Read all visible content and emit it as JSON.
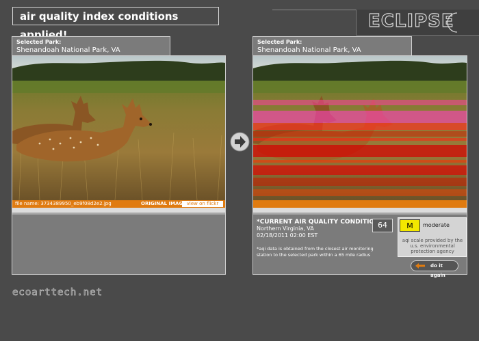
{
  "header": {
    "banner": "air quality index conditions applied!",
    "logo": "ECLIPSE",
    "logo_icon": "crescent-moon-icon"
  },
  "left_panel": {
    "label": "Selected Park:",
    "park": "Shenandoah National Park, VA",
    "file_name": "file name: 3734389950_eb9f08d2e2.jpg",
    "original_label": "ORIGINAL IMAGE",
    "flickr_button": "view on flickr"
  },
  "right_panel": {
    "label": "Selected Park:",
    "park": "Shenandoah National Park, VA"
  },
  "aqi": {
    "title": "*CURRENT AIR QUALITY CONDITIONS",
    "location": "Northern Virginia, VA",
    "datetime": "02/18/2011 02:00 EST",
    "value": "64",
    "note_line1": "*aqi data is obtained from the closest air monitoring",
    "note_line2": "station to the selected park within a 65 mile radius",
    "legend_code": "M",
    "legend_label": "moderate",
    "legend_note": "aqi scale provided by the u.s. environmental protection agency",
    "again_button": "do it again"
  },
  "footer": {
    "site": "ecoarttech.net"
  },
  "colors": {
    "background": "#4a4a4a",
    "panel": "#7b7b7b",
    "accent_orange": "#e07b10",
    "moderate_yellow": "#f3e800"
  }
}
